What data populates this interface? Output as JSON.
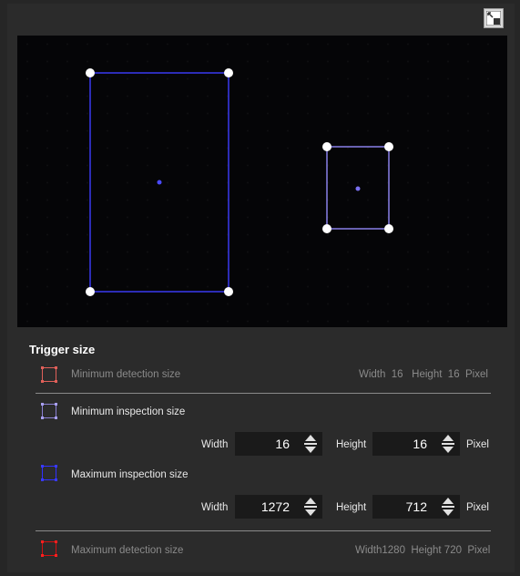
{
  "trigger_size": {
    "title": "Trigger size",
    "min_detection": {
      "label": "Minimum detection size",
      "info": "Width  16   Height  16  Pixel",
      "color": "#e0605a"
    },
    "min_inspection": {
      "label": "Minimum inspection size",
      "width_label": "Width",
      "width_value": "16",
      "height_label": "Height",
      "height_value": "16",
      "unit": "Pixel",
      "color": "#8a80d0"
    },
    "max_inspection": {
      "label": "Maximum inspection size",
      "width_label": "Width",
      "width_value": "1272",
      "height_label": "Height",
      "height_value": "712",
      "unit": "Pixel",
      "color": "#3030ff"
    },
    "max_detection": {
      "label": "Maximum detection size",
      "info": "Width1280  Height 720  Pixel",
      "color": "#d01010"
    }
  },
  "icons": {
    "expand": "expand-view-icon",
    "spinner_up": "triangle-up-icon",
    "spinner_down": "triangle-down-icon"
  },
  "colors": {
    "max_inspection_box": "#3a3af0",
    "min_inspection_box": "#8a80e8",
    "handle": "#ffffff"
  }
}
